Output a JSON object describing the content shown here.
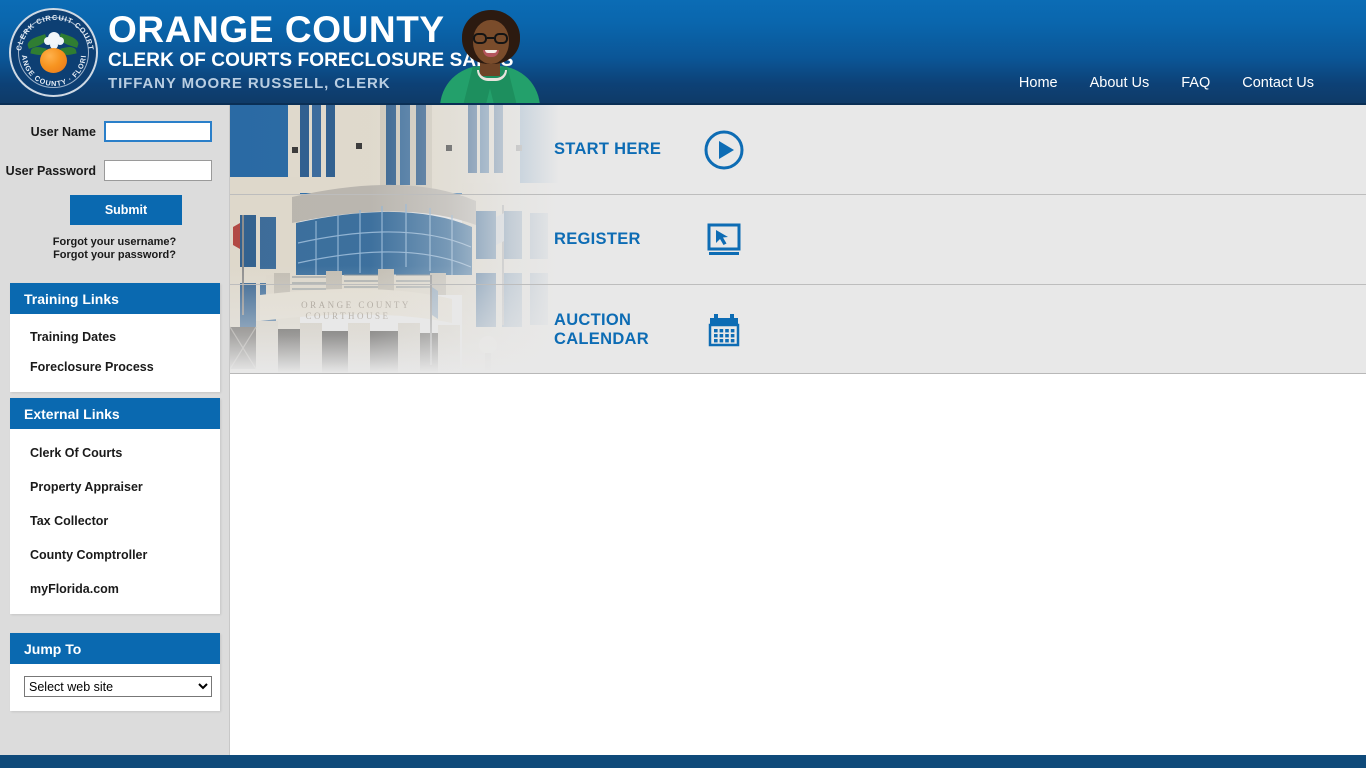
{
  "header": {
    "seal": {
      "top_text": "CLERK CIRCUIT COURT",
      "bottom_text": "ORANGE COUNTY · FLORIDA",
      "icon": "orange-seal-icon"
    },
    "title_main": "ORANGE COUNTY",
    "title_sub": "CLERK OF COURTS FORECLOSURE SALES",
    "title_clerk": "TIFFANY MOORE RUSSELL, CLERK",
    "portrait_alt": "clerk-portrait",
    "nav": [
      {
        "label": "Home",
        "name": "nav-home"
      },
      {
        "label": "About Us",
        "name": "nav-about-us"
      },
      {
        "label": "FAQ",
        "name": "nav-faq"
      },
      {
        "label": "Contact Us",
        "name": "nav-contact-us"
      }
    ]
  },
  "login": {
    "username_label": "User Name",
    "username_value": "",
    "username_placeholder": "",
    "password_label": "User Password",
    "password_value": "",
    "password_placeholder": "",
    "submit_label": "Submit",
    "forgot_username": "Forgot your username?",
    "forgot_password": "Forgot your password?"
  },
  "sidebar": {
    "sections": [
      {
        "title": "Training Links",
        "name": "training-links",
        "links": [
          {
            "label": "Training Dates",
            "name": "sidebar-item-training-dates"
          },
          {
            "label": "Foreclosure Process",
            "name": "sidebar-item-foreclosure-process"
          }
        ]
      },
      {
        "title": "External Links",
        "name": "external-links",
        "links": [
          {
            "label": "Clerk Of Courts",
            "name": "sidebar-item-clerk-of-courts"
          },
          {
            "label": "Property Appraiser",
            "name": "sidebar-item-property-appraiser"
          },
          {
            "label": "Tax Collector",
            "name": "sidebar-item-tax-collector"
          },
          {
            "label": "County Comptroller",
            "name": "sidebar-item-county-comptroller"
          },
          {
            "label": "myFlorida.com",
            "name": "sidebar-item-myflorida"
          }
        ]
      }
    ],
    "jump_to": {
      "title": "Jump To",
      "selected": "Select web site",
      "options": [
        "Select web site"
      ]
    }
  },
  "hero": {
    "background_image": "orange-county-courthouse-photo",
    "items": [
      {
        "label": "START HERE",
        "icon": "play-circle-icon",
        "name": "hero-start-here"
      },
      {
        "label": "REGISTER",
        "icon": "monitor-cursor-icon",
        "name": "hero-register"
      },
      {
        "label": "AUCTION CALENDAR",
        "label_line1": "AUCTION",
        "label_line2": "CALENDAR",
        "icon": "calendar-icon",
        "name": "hero-auction-calendar"
      }
    ]
  },
  "colors": {
    "brand_blue": "#0a69b0",
    "header_top": "#0b6cb5",
    "header_bottom": "#0f3a66",
    "link_blue": "#0d6cb4",
    "footer": "#0f4a7a",
    "panel_gray": "#dcdcdc",
    "hero_gray": "#e8e8e8"
  }
}
